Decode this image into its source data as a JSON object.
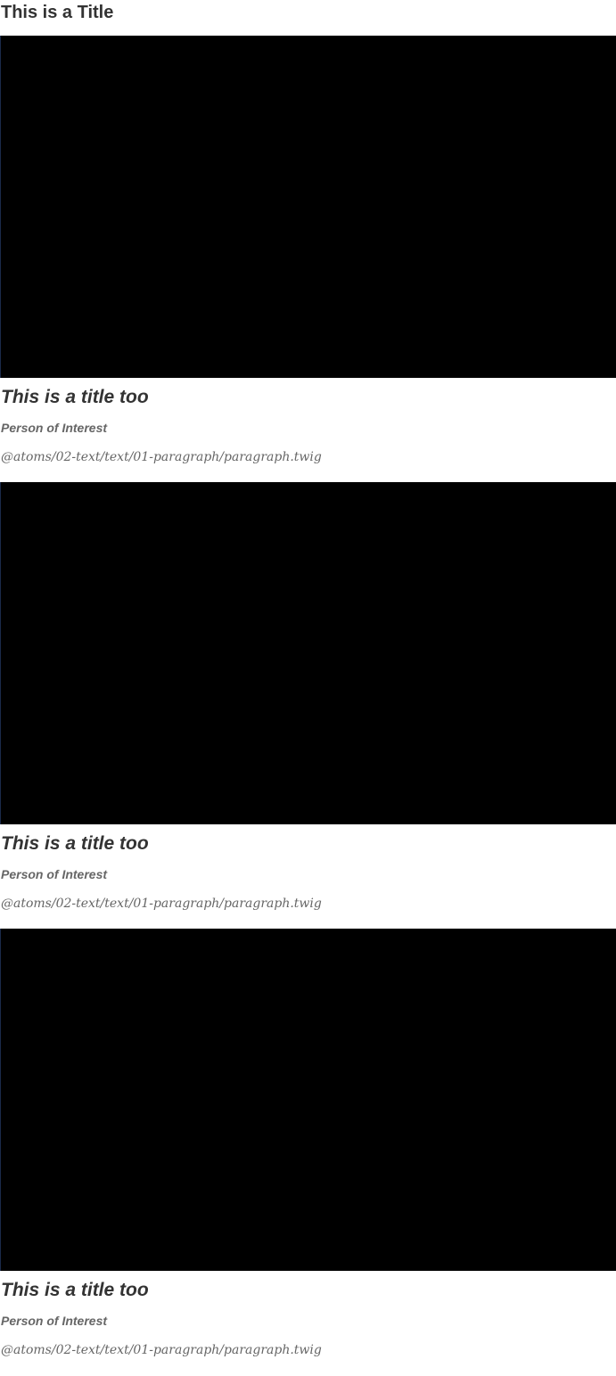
{
  "page": {
    "title": "This is a Title"
  },
  "cards": [
    {
      "title": "This is a title too",
      "person": "Person of Interest",
      "path": "@atoms/02-text/text/01-paragraph/paragraph.twig"
    },
    {
      "title": "This is a title too",
      "person": "Person of Interest",
      "path": "@atoms/02-text/text/01-paragraph/paragraph.twig"
    },
    {
      "title": "This is a title too",
      "person": "Person of Interest",
      "path": "@atoms/02-text/text/01-paragraph/paragraph.twig"
    }
  ],
  "colors": {
    "text": "#333333",
    "muted": "#666666",
    "video": "#000000"
  }
}
